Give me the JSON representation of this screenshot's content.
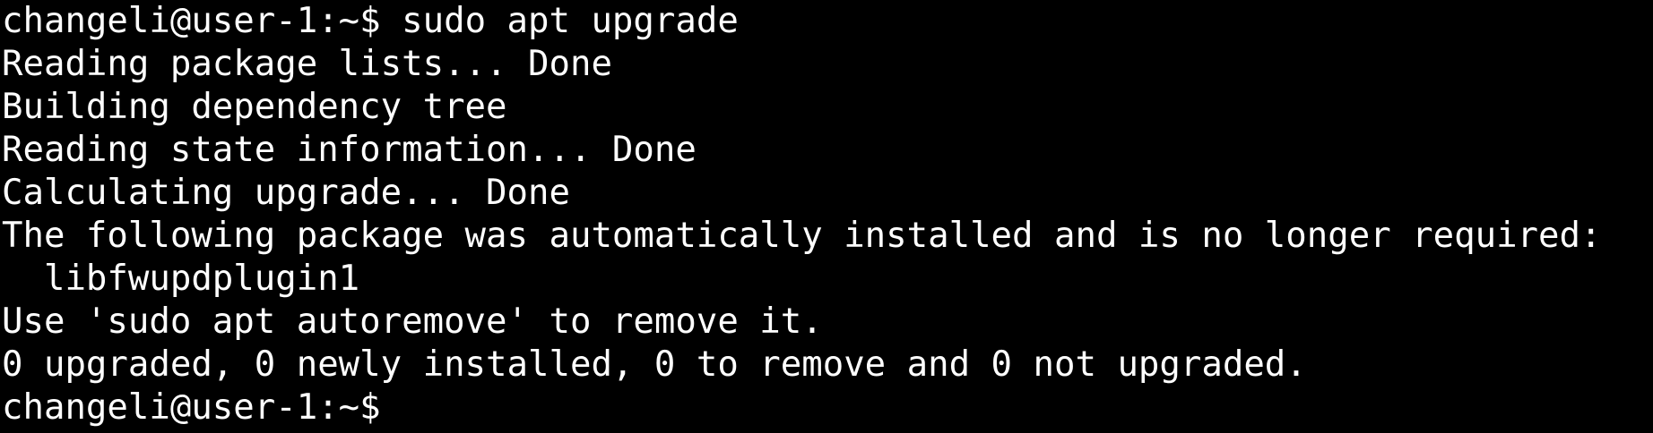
{
  "terminal": {
    "colors": {
      "background": "#000000",
      "foreground": "#ffffff"
    },
    "prompt": "changeli@user-1:~$",
    "command": "sudo apt upgrade",
    "output": [
      "Reading package lists... Done",
      "Building dependency tree",
      "Reading state information... Done",
      "Calculating upgrade... Done",
      "The following package was automatically installed and is no longer required:",
      "  libfwupdplugin1",
      "Use 'sudo apt autoremove' to remove it.",
      "0 upgraded, 0 newly installed, 0 to remove and 0 not upgraded."
    ],
    "final_prompt": "changeli@user-1:~$"
  }
}
